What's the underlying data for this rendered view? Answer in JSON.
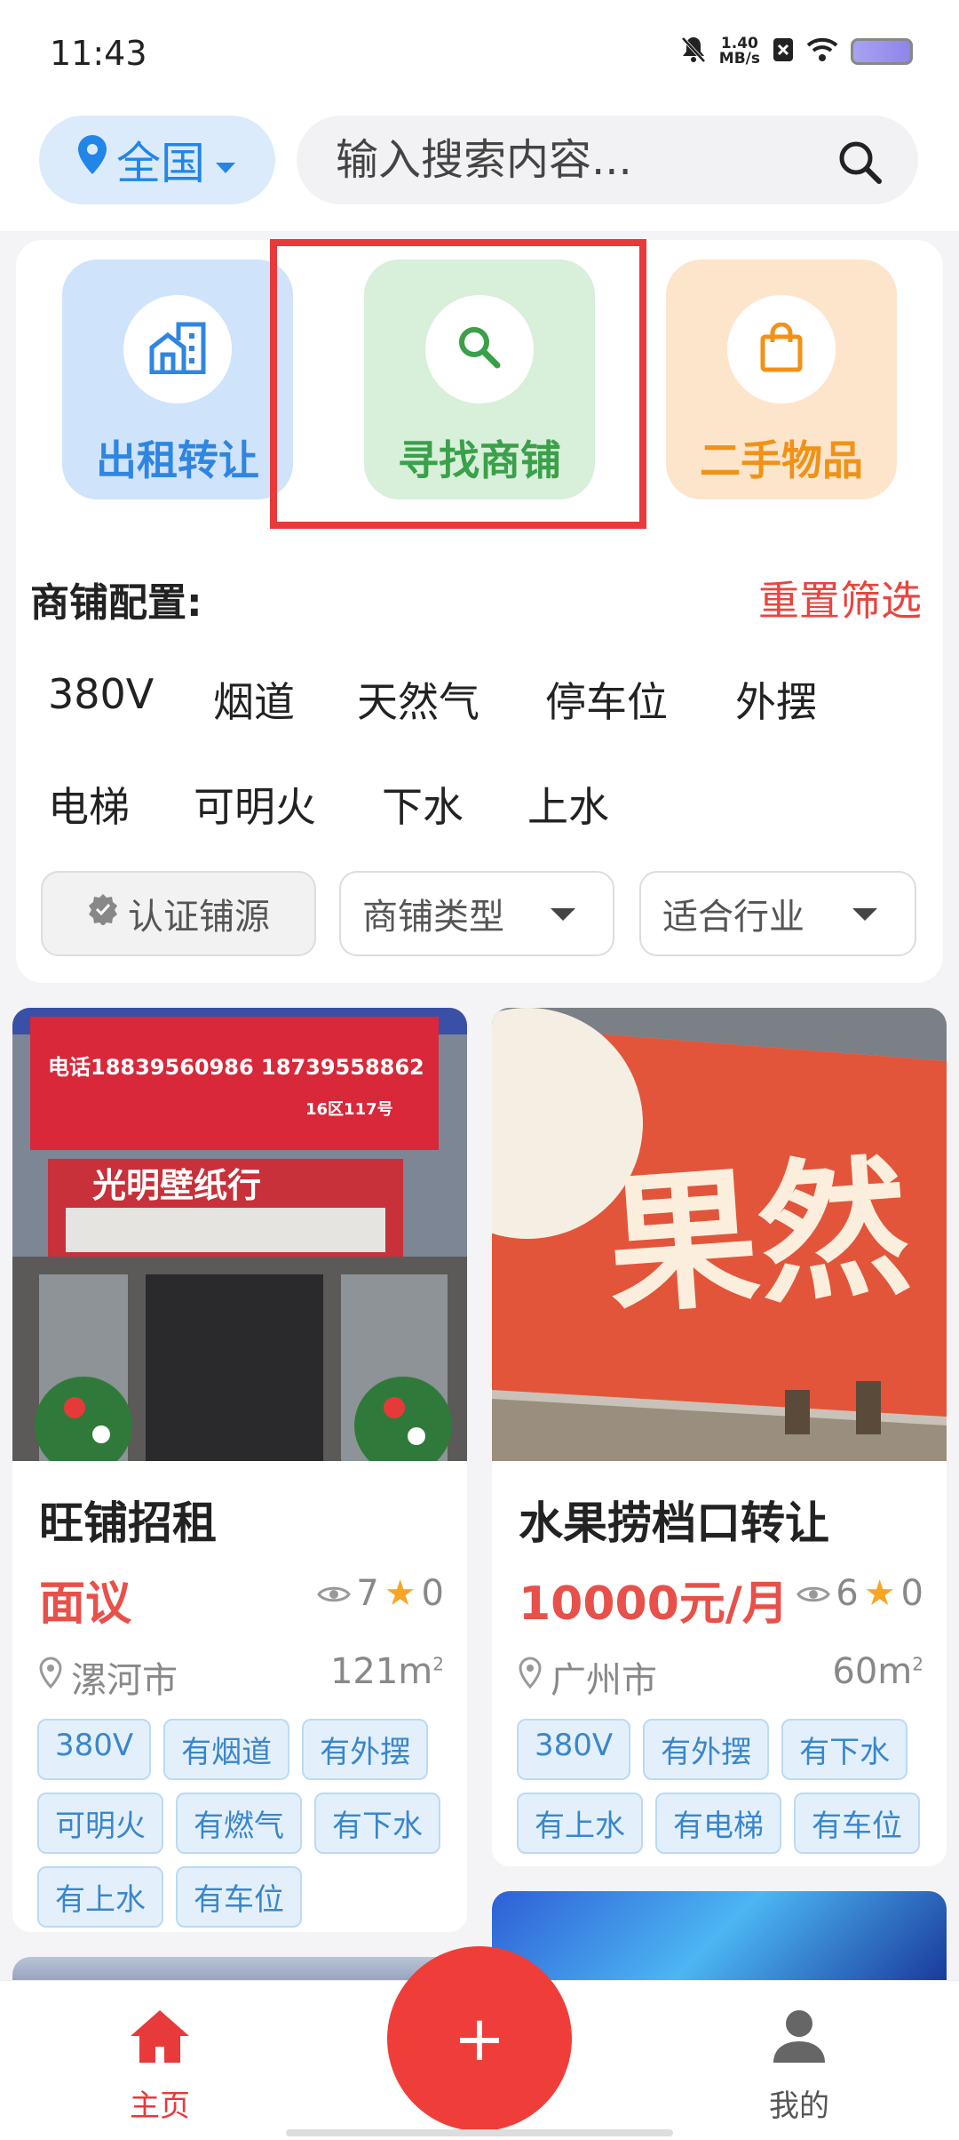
{
  "status_bar": {
    "time": "11:43",
    "speed_value": "1.40",
    "speed_unit": "MB/s"
  },
  "header": {
    "location": "全国",
    "search_placeholder": "输入搜索内容..."
  },
  "categories": [
    {
      "label": "出租转让"
    },
    {
      "label": "寻找商铺"
    },
    {
      "label": "二手物品"
    }
  ],
  "filters": {
    "title": "商铺配置:",
    "reset": "重置筛选",
    "options": [
      "380V",
      "烟道",
      "天然气",
      "停车位",
      "外摆",
      "电梯",
      "可明火",
      "下水",
      "上水"
    ],
    "certified": "认证铺源",
    "shop_type": "商铺类型",
    "industry": "适合行业"
  },
  "listings": [
    {
      "title": "旺铺招租",
      "price": "面议",
      "views": "7",
      "favorites": "0",
      "city": "漯河市",
      "area": "121m",
      "area_sup": "2",
      "tags": [
        "380V",
        "有烟道",
        "有外摆",
        "可明火",
        "有燃气",
        "有下水",
        "有上水",
        "有车位"
      ],
      "photo_phone": "电话18839560986 18739558862",
      "photo_district": "16区117号",
      "photo_sign": "光明壁纸行"
    },
    {
      "title": "水果捞档口转让",
      "price": "10000元/月",
      "views": "6",
      "favorites": "0",
      "city": "广州市",
      "area": "60m",
      "area_sup": "2",
      "tags": [
        "380V",
        "有外摆",
        "有下水",
        "有上水",
        "有电梯",
        "有车位"
      ],
      "photo_sign": "果然"
    }
  ],
  "bottom_nav": {
    "home": "主页",
    "add": "+",
    "me": "我的"
  },
  "colors": {
    "primary_red": "#e8393b",
    "blue": "#2186e8",
    "green": "#3aa04a",
    "orange": "#f09218"
  }
}
